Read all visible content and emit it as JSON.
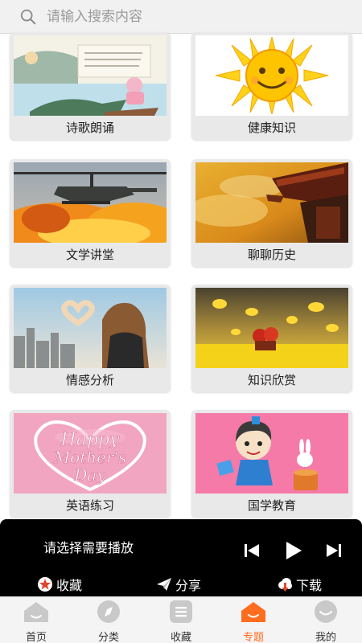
{
  "search": {
    "placeholder": "请输入搜索内容"
  },
  "categories": [
    {
      "label": "诗歌朗诵"
    },
    {
      "label": "健康知识"
    },
    {
      "label": "文学讲堂"
    },
    {
      "label": "聊聊历史"
    },
    {
      "label": "情感分析"
    },
    {
      "label": "知识欣赏"
    },
    {
      "label": "英语练习"
    },
    {
      "label": "国学教育"
    }
  ],
  "player": {
    "now_playing": "请选择需要播放",
    "favorite_label": "收藏",
    "share_label": "分享",
    "download_label": "下载"
  },
  "nav": {
    "items": [
      {
        "label": "首页"
      },
      {
        "label": "分类"
      },
      {
        "label": "收藏"
      },
      {
        "label": "专题"
      },
      {
        "label": "我的"
      }
    ],
    "active_color": "#ff6d1f"
  }
}
